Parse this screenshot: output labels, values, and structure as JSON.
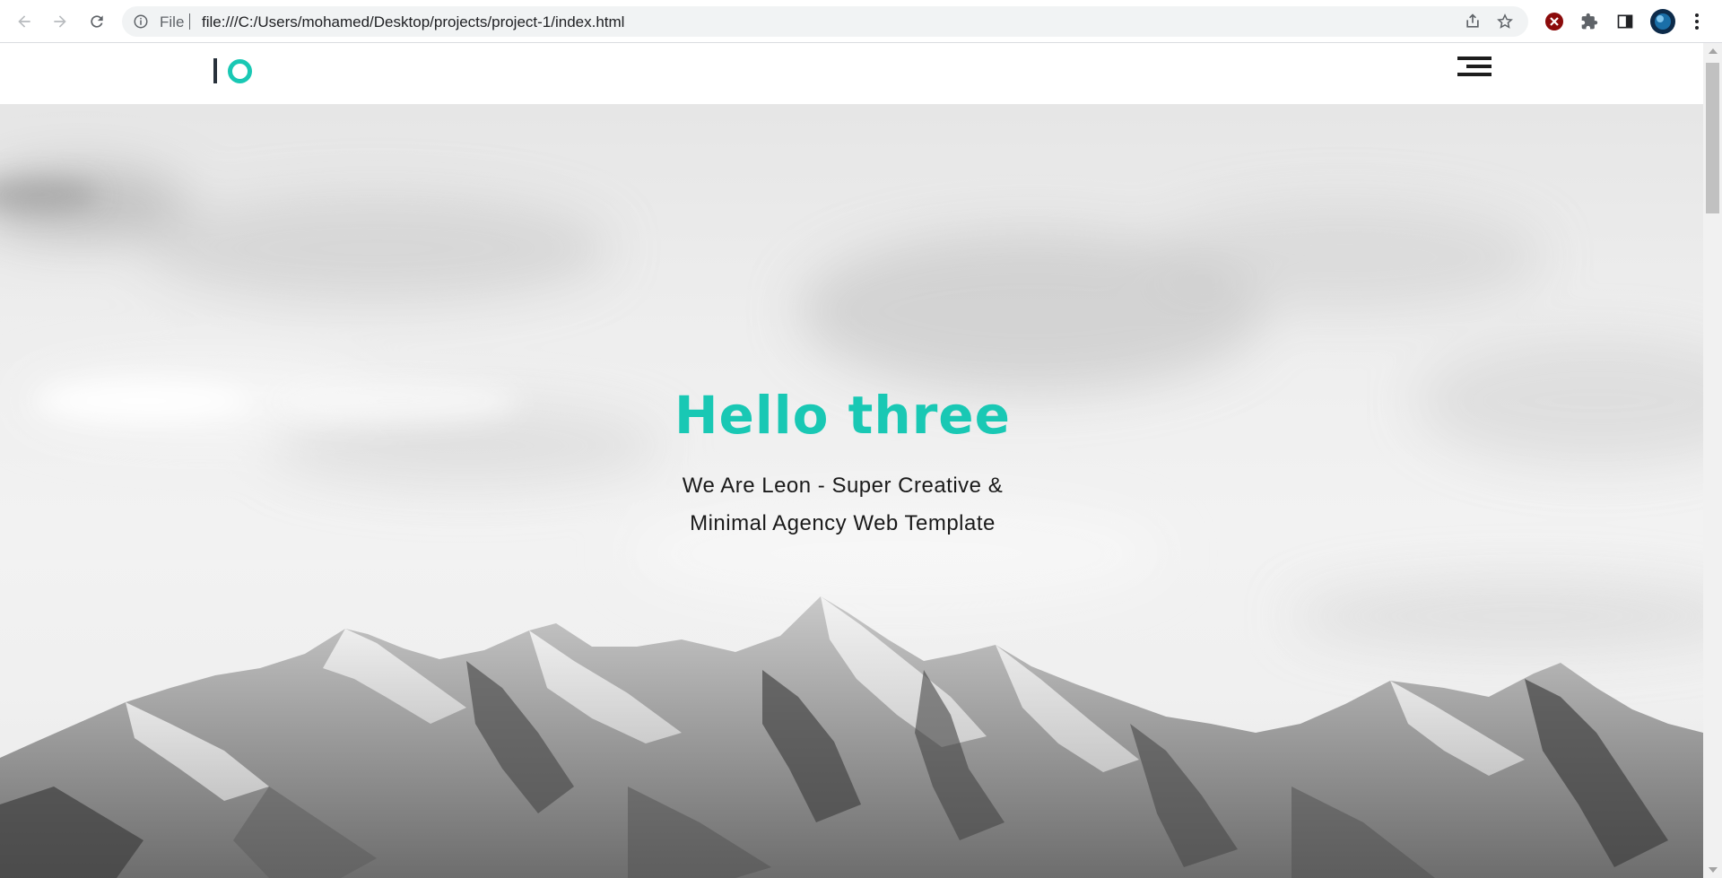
{
  "browser": {
    "scheme_label": "File",
    "url": "file:///C:/Users/mohamed/Desktop/projects/project-1/index.html",
    "icons": [
      "back-icon",
      "forward-icon",
      "reload-icon",
      "info-icon",
      "share-icon",
      "bookmark-star-icon",
      "extension-x-icon",
      "puzzle-icon",
      "side-panel-icon",
      "profile-avatar",
      "kebab-menu-icon"
    ]
  },
  "site": {
    "logo_icon": "io-logo",
    "menu_icon": "hamburger-menu-icon"
  },
  "hero": {
    "title": "Hello three",
    "subtitle_line1": "We Are Leon - Super Creative &",
    "subtitle_line2": "Minimal Agency Web Template"
  },
  "colors": {
    "accent": "#19c8b4",
    "text_dark": "#1a1a1a",
    "logo_bar": "#28313b"
  }
}
